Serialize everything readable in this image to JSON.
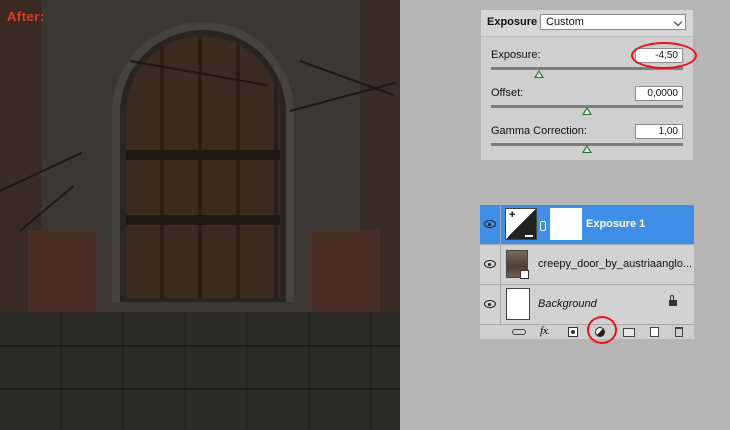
{
  "photo": {
    "label": "After:"
  },
  "properties": {
    "title": "Exposure",
    "preset": "Custom",
    "params": [
      {
        "label": "Exposure:",
        "value": "-4,50",
        "slider": 0.25
      },
      {
        "label": "Offset:",
        "value": "0,0000",
        "slider": 0.5
      },
      {
        "label": "Gamma Correction:",
        "value": "1,00",
        "slider": 0.5
      }
    ]
  },
  "layers": {
    "rows": [
      {
        "name": "Exposure 1",
        "selected": true
      },
      {
        "name": "creepy_door_by_austriaanglo..."
      },
      {
        "name": "Background",
        "italic": true,
        "locked": true
      }
    ],
    "toolbar": [
      "link-icon",
      "fx-icon",
      "mask-icon",
      "adjustment-icon",
      "folder-icon",
      "new-layer-icon",
      "trash-icon"
    ]
  },
  "colors": {
    "selection": "#3f8ee8",
    "annotation": "#e11111",
    "slider_thumb": "#1f7a1f",
    "label": "#e03b25"
  }
}
